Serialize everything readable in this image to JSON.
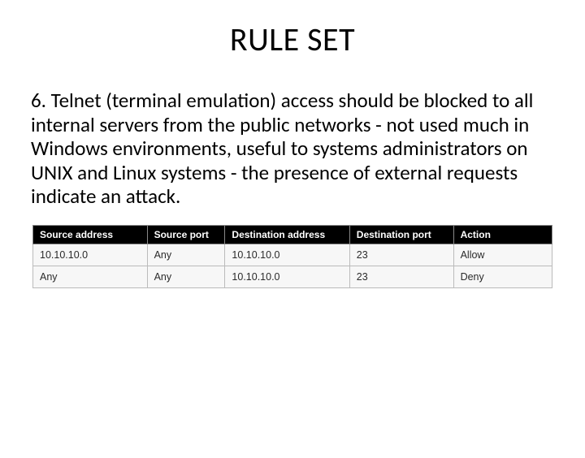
{
  "title": "RULE SET",
  "body": "6. Telnet (terminal emulation) access should be blocked to all internal servers from the public networks -  not used much in Windows environments, useful to systems administrators on UNIX and Linux systems - the presence of external requests indicate an attack.",
  "table": {
    "headers": [
      "Source address",
      "Source port",
      "Destination address",
      "Destination port",
      "Action"
    ],
    "rows": [
      [
        "10.10.10.0",
        "Any",
        "10.10.10.0",
        "23",
        "Allow"
      ],
      [
        "Any",
        "Any",
        "10.10.10.0",
        "23",
        "Deny"
      ]
    ]
  }
}
